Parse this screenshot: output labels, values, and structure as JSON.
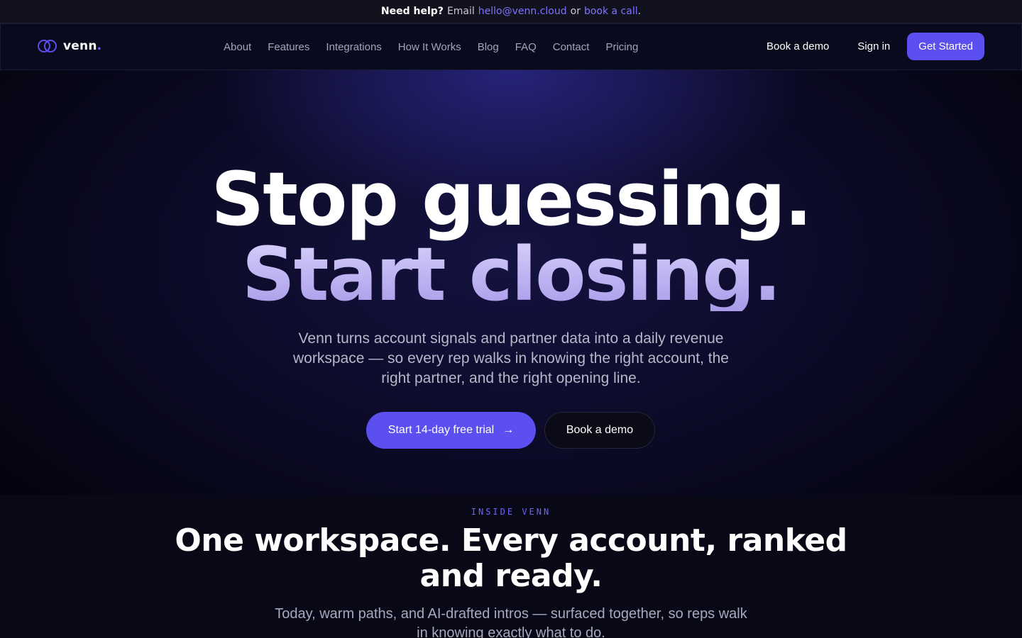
{
  "helpbar": {
    "lead": "Need help?",
    "email_prefix": "Email",
    "email": "hello@venn.cloud",
    "or": "or",
    "call_link": "book a call",
    "end": "."
  },
  "nav": {
    "brand": "venn",
    "brand_dot": ".",
    "links": [
      "About",
      "Features",
      "Integrations",
      "How It Works",
      "Blog",
      "FAQ",
      "Contact",
      "Pricing"
    ],
    "book_demo": "Book a demo",
    "sign_in": "Sign in",
    "get_started": "Get Started"
  },
  "hero": {
    "line1": "Stop guessing.",
    "line2": "Start closing.",
    "subtitle": "Venn turns account signals and partner data into a daily revenue workspace — so every rep walks in knowing the right account, the right partner, and the right opening line.",
    "cta_primary": "Start 14-day free trial",
    "cta_arrow": "→",
    "cta_secondary": "Book a demo"
  },
  "section": {
    "eyebrow": "INSIDE VENN",
    "title": "One workspace. Every account, ranked and ready.",
    "subtitle": "Today, warm paths, and AI-drafted intros — surfaced together, so reps walk in knowing exactly what to do."
  },
  "colors": {
    "accent": "#5b4ff0",
    "link": "#7c73ff",
    "background": "#050513"
  }
}
